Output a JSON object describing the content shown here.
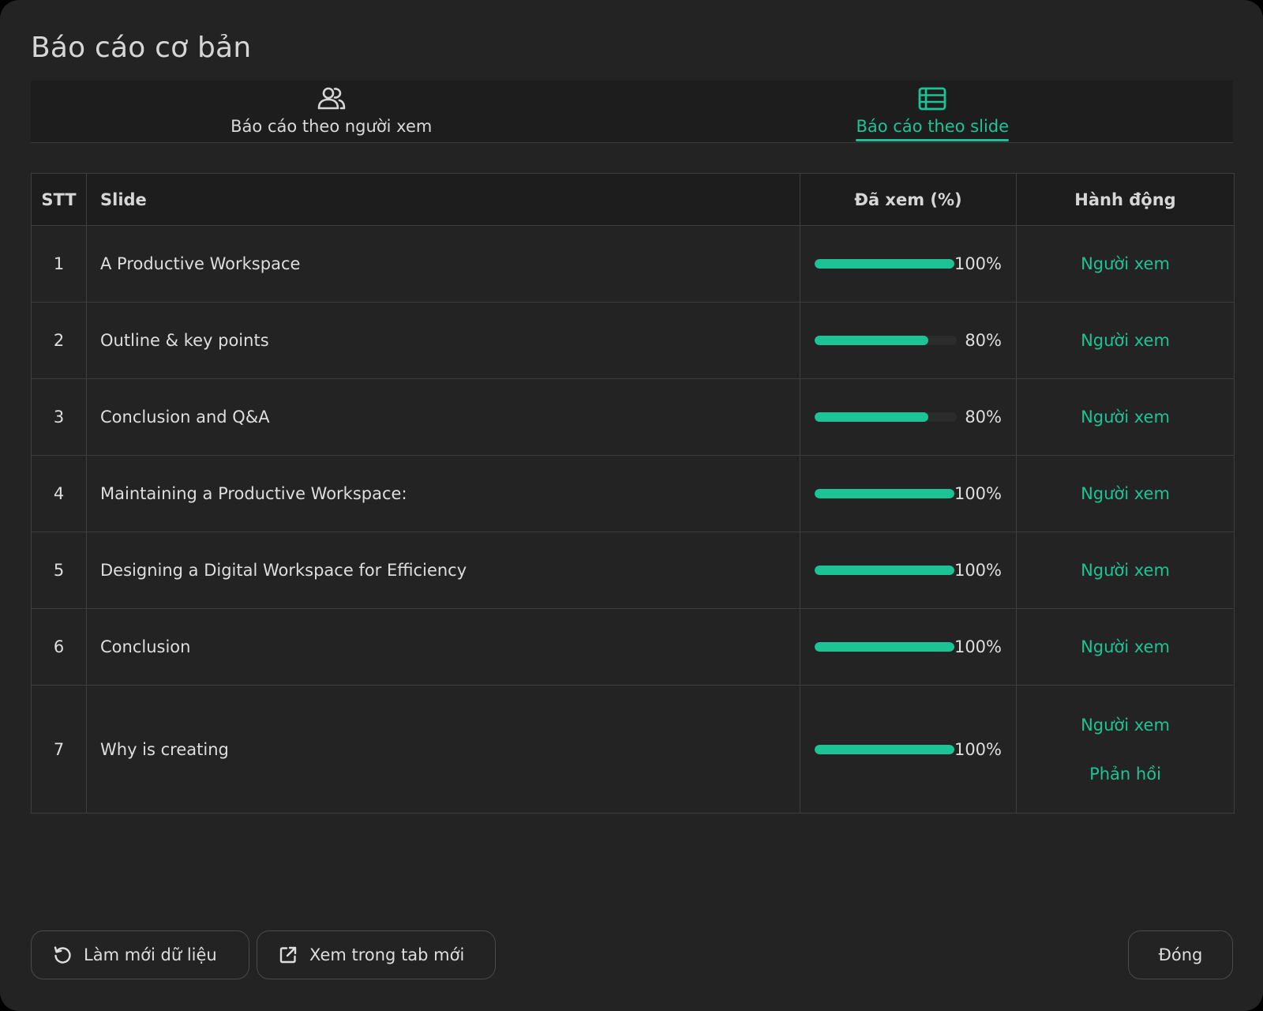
{
  "dialog": {
    "title": "Báo cáo cơ bản"
  },
  "tabs": [
    {
      "label": "Báo cáo theo người xem",
      "icon": "users-icon",
      "active": false
    },
    {
      "label": "Báo cáo theo slide",
      "icon": "table-list-icon",
      "active": true
    }
  ],
  "table": {
    "headers": {
      "stt": "STT",
      "slide": "Slide",
      "viewed": "Đã xem (%)",
      "action": "Hành động"
    },
    "rows": [
      {
        "stt": "1",
        "slide": "A Productive Workspace",
        "percent": 100,
        "percent_label": "100%",
        "actions": [
          "Người xem"
        ]
      },
      {
        "stt": "2",
        "slide": "Outline & key points",
        "percent": 80,
        "percent_label": "80%",
        "actions": [
          "Người xem"
        ]
      },
      {
        "stt": "3",
        "slide": "Conclusion and Q&A",
        "percent": 80,
        "percent_label": "80%",
        "actions": [
          "Người xem"
        ]
      },
      {
        "stt": "4",
        "slide": "Maintaining a Productive Workspace:",
        "percent": 100,
        "percent_label": "100%",
        "actions": [
          "Người xem"
        ]
      },
      {
        "stt": "5",
        "slide": "Designing a Digital Workspace for Efficiency",
        "percent": 100,
        "percent_label": "100%",
        "actions": [
          "Người xem"
        ]
      },
      {
        "stt": "6",
        "slide": "Conclusion",
        "percent": 100,
        "percent_label": "100%",
        "actions": [
          "Người xem"
        ]
      },
      {
        "stt": "7",
        "slide": "Why is creating",
        "percent": 100,
        "percent_label": "100%",
        "actions": [
          "Người xem",
          "Phản hồi"
        ]
      }
    ]
  },
  "footer": {
    "refresh_label": "Làm mới dữ liệu",
    "refresh_icon": "refresh-icon",
    "open_new_tab_label": "Xem trong tab mới",
    "open_new_tab_icon": "external-link-icon",
    "close_label": "Đóng"
  },
  "colors": {
    "accent": "#1cc394",
    "background": "#232323",
    "header_background": "#1d1d1d",
    "border": "#3e3e3e",
    "text": "#dedede"
  }
}
